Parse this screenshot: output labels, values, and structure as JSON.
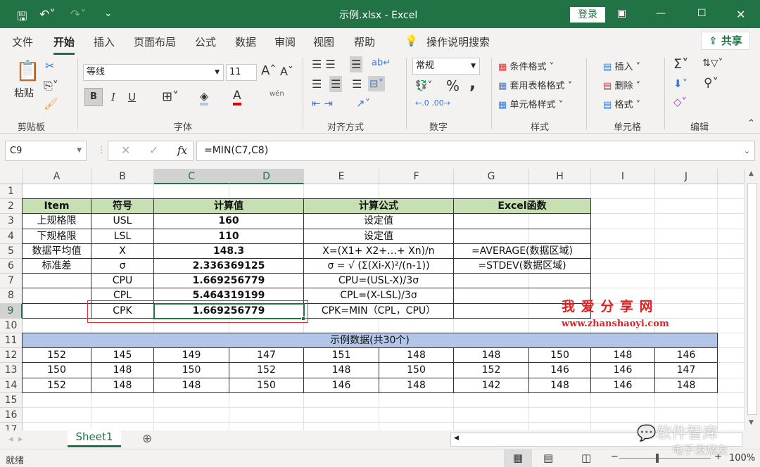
{
  "window": {
    "title": "示例.xlsx  -  Excel",
    "login": "登录"
  },
  "menu": {
    "tabs": [
      "文件",
      "开始",
      "插入",
      "页面布局",
      "公式",
      "数据",
      "审阅",
      "视图",
      "帮助"
    ],
    "search": "操作说明搜索",
    "share": "共享"
  },
  "ribbon": {
    "clipboard": {
      "paste": "粘贴",
      "label": "剪贴板"
    },
    "font": {
      "name": "等线",
      "size": "11",
      "bold": "B",
      "italic": "I",
      "underline": "U",
      "label": "字体",
      "phonetic": "wén"
    },
    "align": {
      "label": "对齐方式"
    },
    "number": {
      "format": "常规",
      "label": "数字",
      "percent": "%",
      "comma": ","
    },
    "styles": {
      "items": [
        "条件格式",
        "套用表格格式",
        "单元格样式"
      ],
      "label": "样式"
    },
    "cells": {
      "items": [
        "插入",
        "删除",
        "格式"
      ],
      "label": "单元格"
    },
    "editing": {
      "label": "编辑",
      "sum": "Σ"
    }
  },
  "formula_bar": {
    "name_box": "C9",
    "fx": "fx",
    "formula": "=MIN(C7,C8)"
  },
  "columns": [
    "A",
    "B",
    "C",
    "D",
    "E",
    "F",
    "G",
    "H",
    "I",
    "J"
  ],
  "rows": [
    "1",
    "2",
    "3",
    "4",
    "5",
    "6",
    "7",
    "8",
    "9",
    "10",
    "11",
    "12",
    "13",
    "14",
    "15",
    "16",
    "17"
  ],
  "summary_table": {
    "header": [
      "Item",
      "符号",
      "计算值",
      "计算公式",
      "Excel函数"
    ],
    "rows": [
      [
        "上规格限",
        "USL",
        "160",
        "设定值",
        ""
      ],
      [
        "下规格限",
        "LSL",
        "110",
        "设定值",
        ""
      ],
      [
        "数据平均值",
        "X",
        "148.3",
        "X=(X1+ X2+…+ Xn)/n",
        "=AVERAGE(数据区域)"
      ],
      [
        "标准差",
        "σ",
        "2.336369125",
        "σ = √ (Σ(Xi-X)²/(n-1))",
        "=STDEV(数据区域)"
      ],
      [
        "",
        "CPU",
        "1.669256779",
        "CPU=(USL-X)/3σ",
        ""
      ],
      [
        "",
        "CPL",
        "5.464319199",
        "CPL=(X-LSL)/3σ",
        ""
      ],
      [
        "",
        "CPK",
        "1.669256779",
        "CPK=MIN（CPL，CPU）",
        ""
      ]
    ]
  },
  "sample_table": {
    "title": "示例数据(共30个)",
    "rows": [
      [
        "152",
        "145",
        "149",
        "147",
        "151",
        "148",
        "148",
        "150",
        "148",
        "146"
      ],
      [
        "150",
        "148",
        "150",
        "152",
        "148",
        "150",
        "152",
        "146",
        "146",
        "147"
      ],
      [
        "152",
        "148",
        "148",
        "150",
        "146",
        "148",
        "142",
        "148",
        "146",
        "148"
      ]
    ]
  },
  "selected_cell": "C9",
  "watermark": {
    "site_name": "我 爱 分 享 网",
    "site_url": "www.zhanshaoyi.com",
    "logo1": "软件智库",
    "logo2": "电子发烧友"
  },
  "sheet_tabs": [
    "Sheet1"
  ],
  "status": {
    "text": "就绪",
    "zoom": "100%"
  },
  "colors": {
    "excel_green": "#217346",
    "header_fill": "#c6e0b4",
    "title_fill": "#b4c6e7",
    "highlight_box": "#e03030"
  }
}
